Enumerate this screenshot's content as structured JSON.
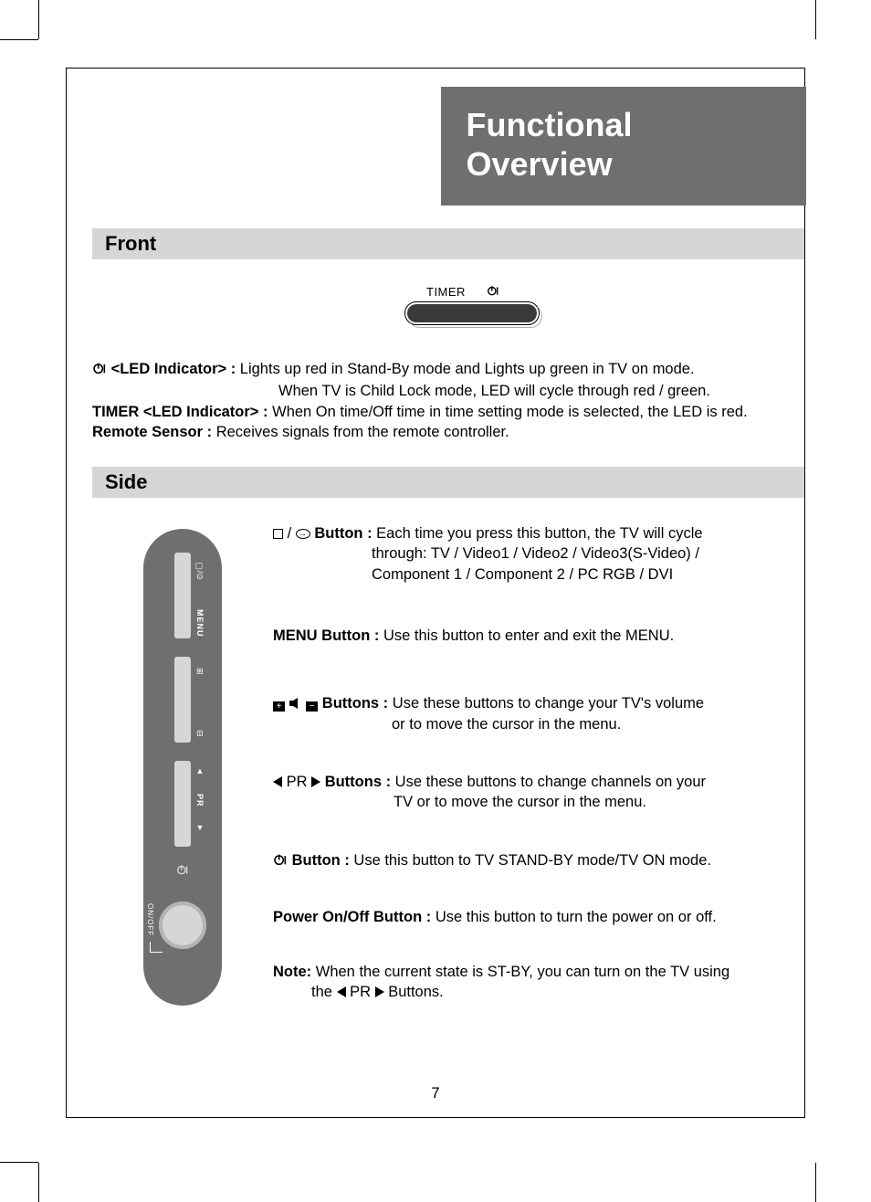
{
  "title": "Functional Overview",
  "section_front": "Front",
  "section_side": "Side",
  "timer_label": "TIMER",
  "front": {
    "led_label": "<LED Indicator> :",
    "led_desc_1": " Lights up red in Stand-By mode and Lights up green in TV on mode.",
    "led_desc_2": "When TV is Child Lock mode, LED will cycle through red / green.",
    "timer_label": "TIMER <LED Indicator> :",
    "timer_desc": " When On time/Off time in time setting mode is selected, the LED is red.",
    "remote_label": "Remote Sensor :",
    "remote_desc": " Receives signals from the remote controller."
  },
  "side_labels": {
    "menu": "MENU",
    "pr": "PR",
    "onoff": "ON/OFF"
  },
  "side": {
    "source_label": "  Button :",
    "source_desc_1": " Each time you press this button, the TV will cycle",
    "source_desc_2": "through: TV / Video1 / Video2 / Video3(S-Video) /",
    "source_desc_3": "Component 1 / Component 2 / PC RGB / DVI",
    "menu_label": "MENU Button :",
    "menu_desc": " Use this button to enter and exit the MENU.",
    "vol_label": "  Buttons :",
    "vol_desc_1": " Use these buttons to change your TV's volume",
    "vol_desc_2": "or to move the cursor in the menu.",
    "pr_prefix": " PR ",
    "pr_label": "Buttons :",
    "pr_desc_1": " Use these buttons to change channels on your",
    "pr_desc_2": "TV or to move the cursor in the menu.",
    "standby_label": "Button :",
    "standby_desc": " Use this button to TV STAND-BY mode/TV ON mode.",
    "power_label": "Power On/Off Button :",
    "power_desc": " Use this button to turn the power on or off.",
    "note_label": "Note:",
    "note_desc_1": " When the current state is ST-BY, you can turn on the TV using",
    "note_desc_2_a": "the ",
    "note_desc_2_b": " PR ",
    "note_desc_2_c": " Buttons."
  },
  "page_number": "7"
}
